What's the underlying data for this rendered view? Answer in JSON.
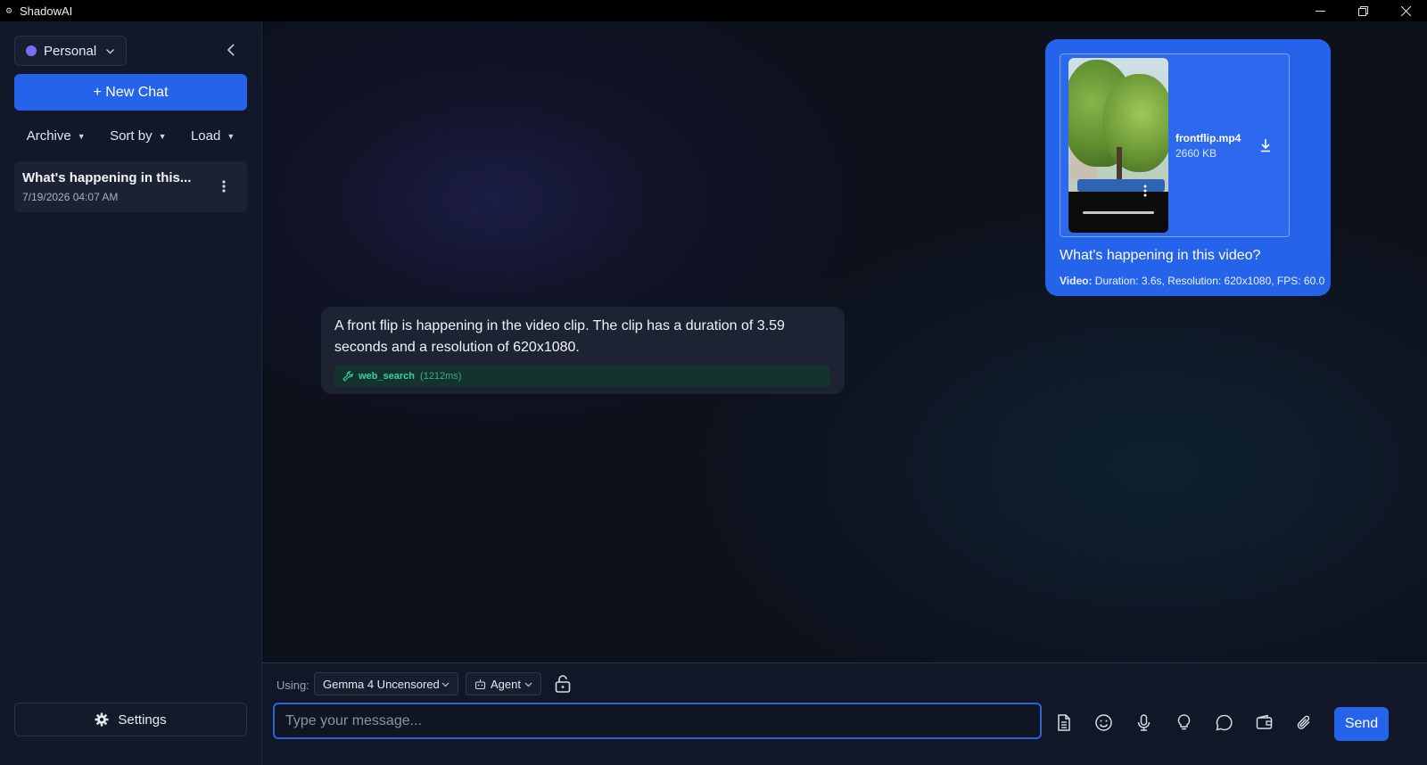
{
  "window": {
    "title": "ShadowAI",
    "controls": [
      "minimize-icon",
      "restore-icon",
      "close-icon"
    ]
  },
  "sidebar": {
    "workspace": {
      "label": "Personal",
      "dot_color": "#7b6cf6"
    },
    "new_chat_label": "+ New Chat",
    "filters": [
      "Archive",
      "Sort by",
      "Load"
    ],
    "chats": [
      {
        "title": "What's happening in this...",
        "date": "7/19/2026 04:07 AM"
      }
    ],
    "settings_label": "Settings"
  },
  "conversation": {
    "user_message": {
      "attachment": {
        "file_name": "frontflip.mp4",
        "file_size": "2660 KB"
      },
      "text": "What's happening in this video?",
      "meta_label": "Video:",
      "meta_value": "Duration: 3.6s, Resolution: 620x1080, FPS: 60.0"
    },
    "ai_message": {
      "text": "A front flip is happening in the video clip. The clip has a duration of 3.59 seconds and a resolution of 620x1080.",
      "tool": {
        "name": "web_search",
        "time": "(1212ms)"
      }
    }
  },
  "composer": {
    "using_label": "Using:",
    "model": "Gemma 4 Uncensored",
    "mode": "Agent",
    "input_placeholder": "Type your message...",
    "input_value": "",
    "tool_icons": [
      "document-icon",
      "emoji-icon",
      "microphone-icon",
      "lightbulb-icon",
      "chat-bubble-icon",
      "wallet-icon",
      "attach-icon"
    ],
    "send_label": "Send"
  },
  "colors": {
    "accent": "#2563eb",
    "tool_green": "#34d399",
    "background": "#0d111c",
    "sidebar": "#111829"
  }
}
